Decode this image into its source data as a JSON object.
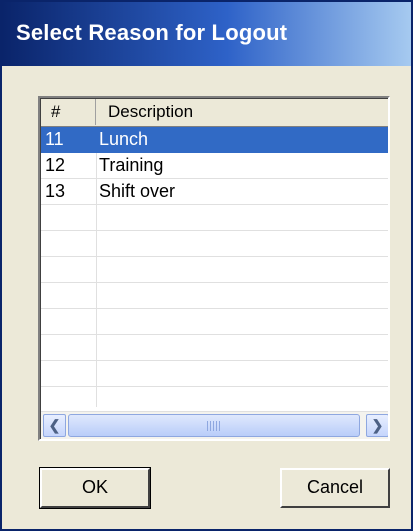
{
  "dialog": {
    "title": "Select Reason for Logout"
  },
  "list": {
    "columns": [
      "#",
      "Description"
    ],
    "rows": [
      {
        "num": "11",
        "desc": "Lunch",
        "selected": true
      },
      {
        "num": "12",
        "desc": "Training",
        "selected": false
      },
      {
        "num": "13",
        "desc": "Shift over",
        "selected": false
      }
    ],
    "empty_row_count": 7
  },
  "scrollbar": {
    "left_icon": "chevron-left-icon",
    "right_icon": "chevron-right-icon",
    "grip_icon": "grip-icon"
  },
  "buttons": {
    "ok_label": "OK",
    "cancel_label": "Cancel"
  },
  "colors": {
    "selection": "#316ac5",
    "title_bar": "#0a246a",
    "window_bg": "#ece9d8"
  }
}
